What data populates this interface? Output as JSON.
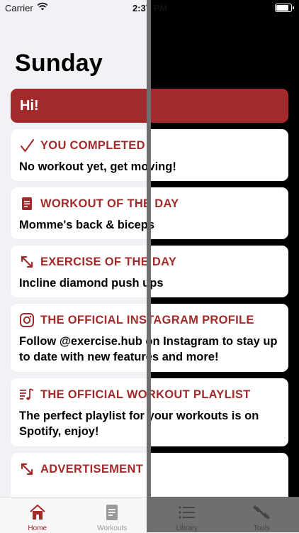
{
  "status_bar": {
    "carrier": "Carrier",
    "time": "2:37 PM"
  },
  "page": {
    "title": "Sunday"
  },
  "banner": {
    "text": "Hi!"
  },
  "cards": [
    {
      "icon": "checkmark-icon",
      "title": "YOU COMPLETED",
      "body": "No workout yet, get moving!"
    },
    {
      "icon": "document-icon",
      "title": "WORKOUT OF THE DAY",
      "body": "Momme's back & biceps"
    },
    {
      "icon": "arrows-expand-icon",
      "title": "EXERCISE OF THE DAY",
      "body": "Incline diamond push ups"
    },
    {
      "icon": "instagram-icon",
      "title": "THE OFFICIAL INSTAGRAM PROFILE",
      "body": "Follow @exercise.hub on Instagram to stay up to date with new features and more!"
    },
    {
      "icon": "music-list-icon",
      "title": "THE OFFICIAL WORKOUT PLAYLIST",
      "body": "The perfect playlist for your workouts is on Spotify, enjoy!"
    },
    {
      "icon": "arrows-expand-icon",
      "title": "ADVERTISEMENT",
      "body": ""
    }
  ],
  "tabs": [
    {
      "label": "Home",
      "icon": "home-icon",
      "active": true
    },
    {
      "label": "Workouts",
      "icon": "clipboard-icon",
      "active": false
    },
    {
      "label": "Library",
      "icon": "list-icon",
      "active": false
    },
    {
      "label": "Tools",
      "icon": "dumbbell-icon",
      "active": false
    }
  ],
  "colors": {
    "accent": "#a32a2a",
    "background": "#f2f2f6",
    "card": "#ffffff"
  }
}
